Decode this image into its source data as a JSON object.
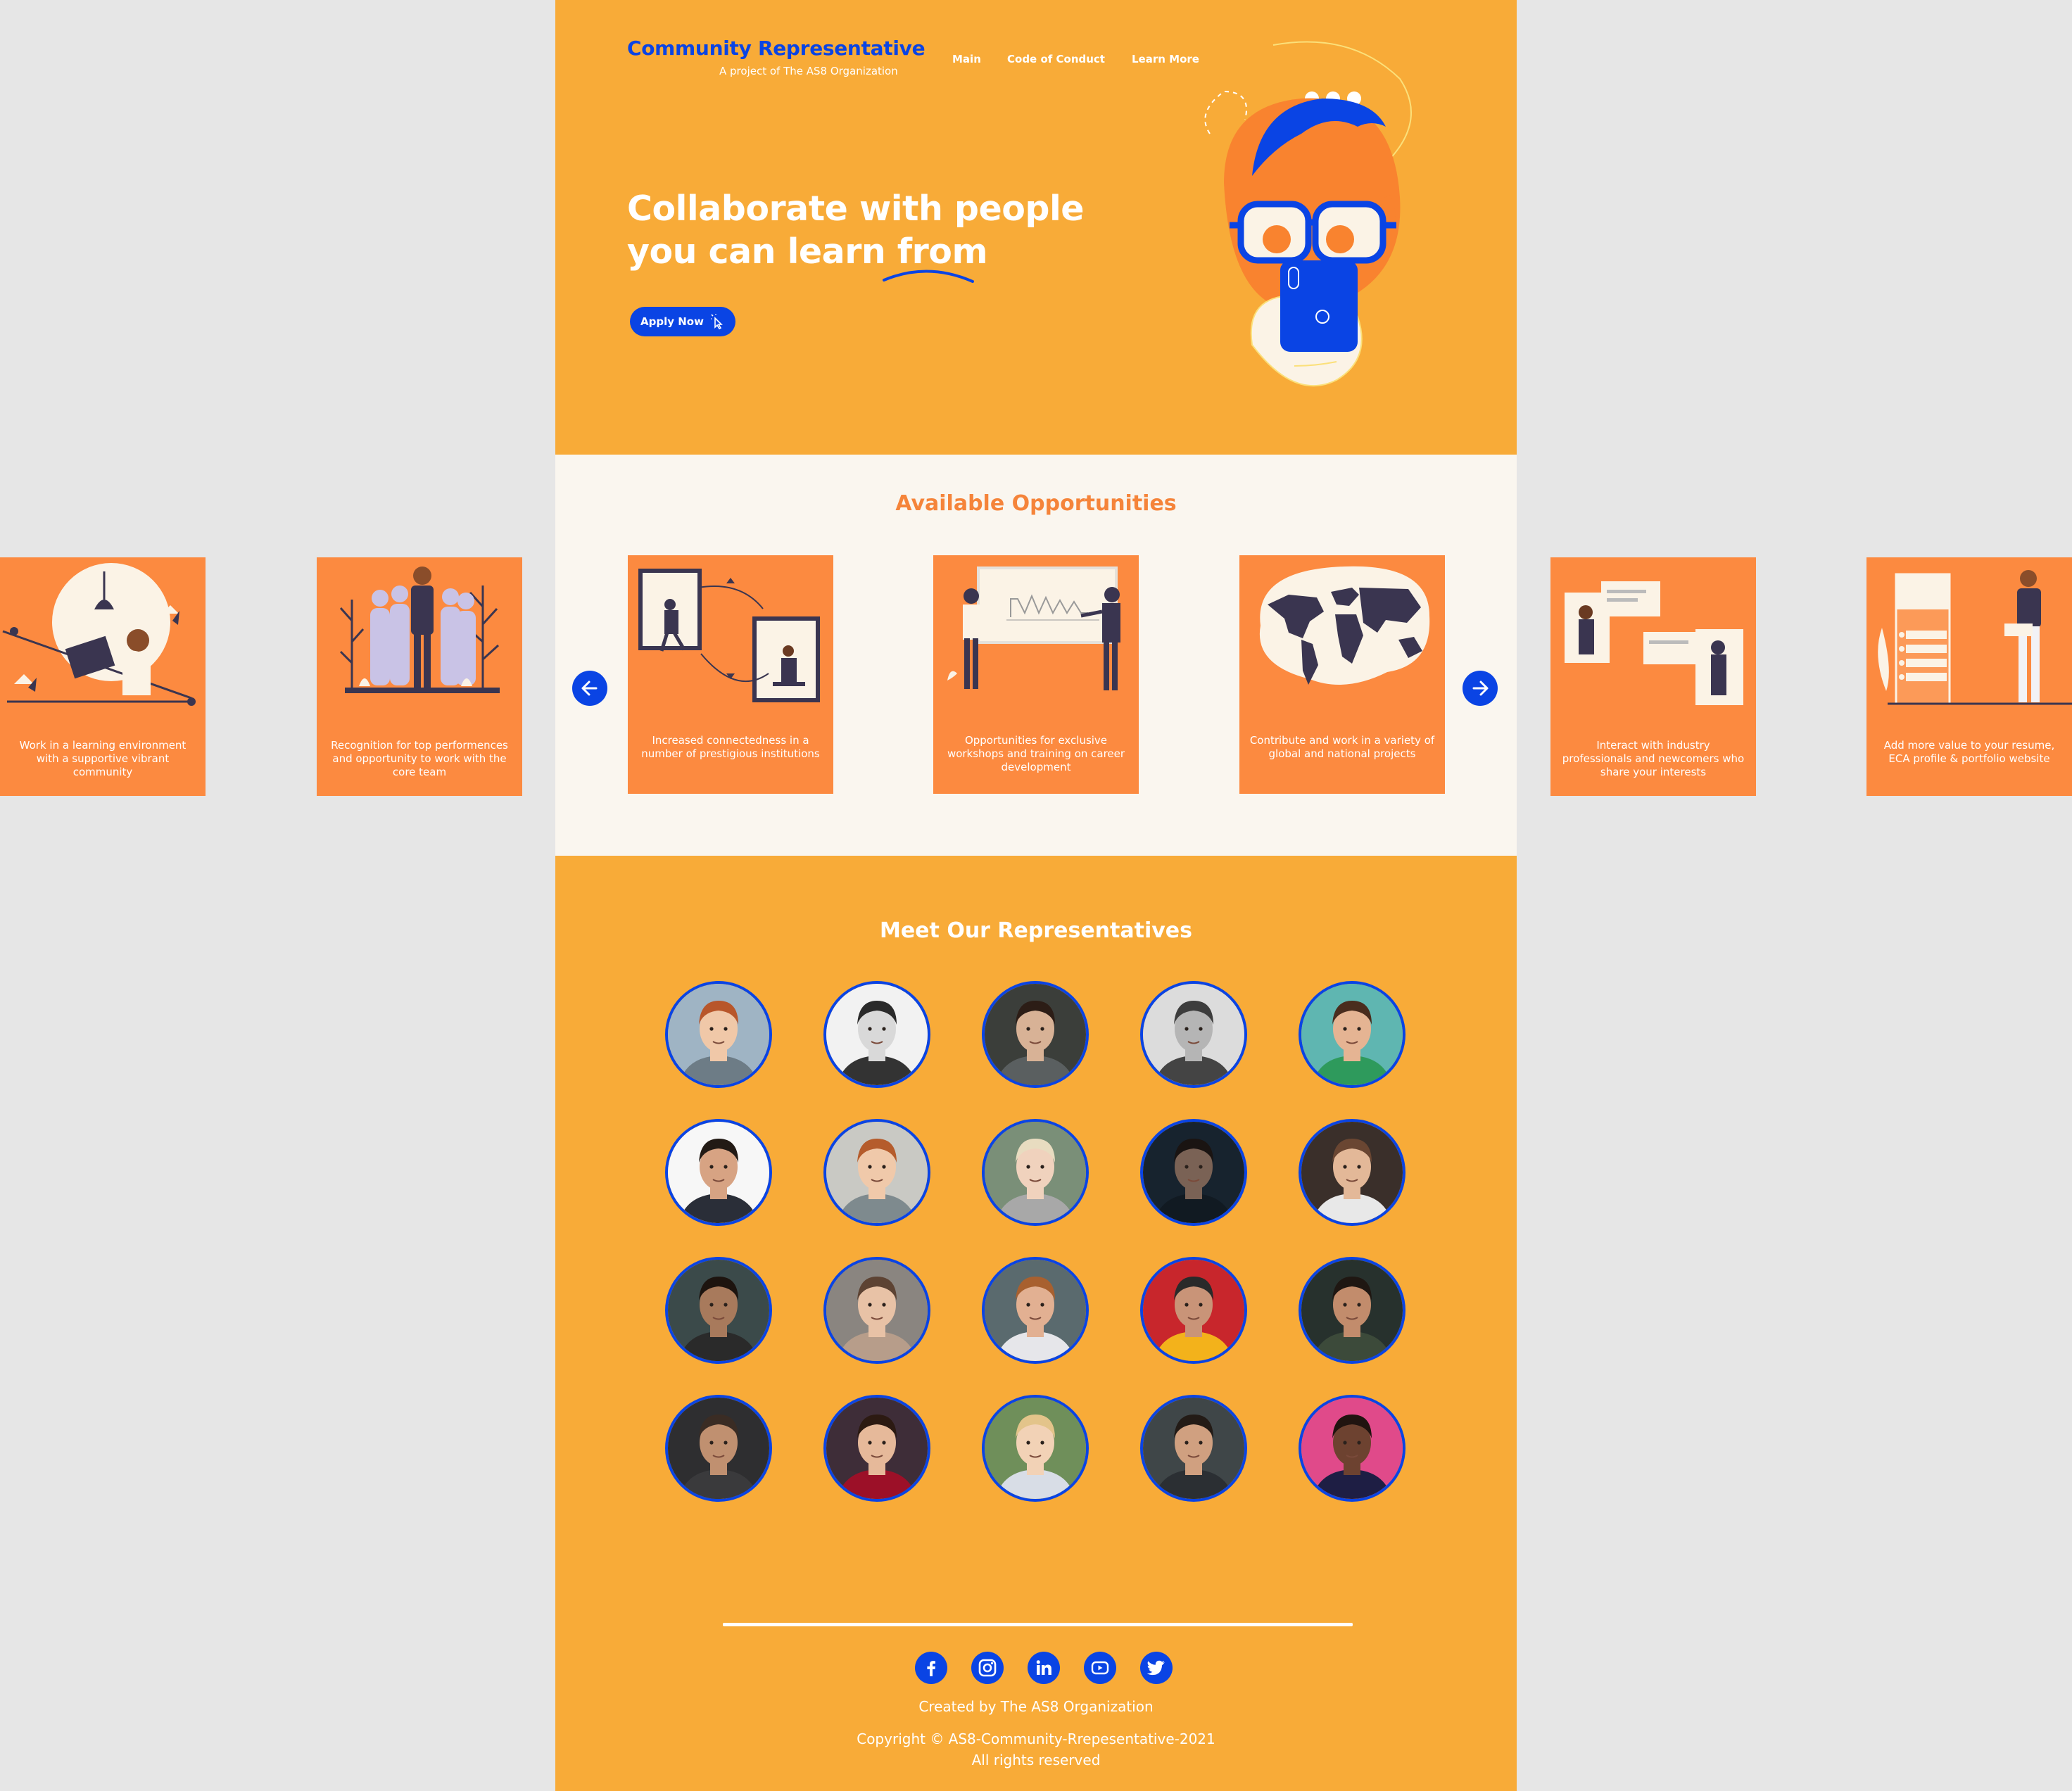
{
  "brand": {
    "title": "Community Representative",
    "subtitle": "A project of The AS8 Organization"
  },
  "nav": {
    "items": [
      {
        "label": "Main"
      },
      {
        "label": "Code of Conduct"
      },
      {
        "label": "Learn More"
      }
    ]
  },
  "hero": {
    "heading_line1": "Collaborate with people",
    "heading_line2": "you can learn from",
    "apply_label": "Apply Now",
    "cursor_icon": "pointer-cursor-icon",
    "illustration": "person-with-glasses-holding-phone"
  },
  "opportunities": {
    "title": "Available Opportunities",
    "prev_icon": "arrow-left-icon",
    "next_icon": "arrow-right-icon",
    "cards": [
      {
        "text": "Work in a learning environment with a supportive vibrant community",
        "illustration": "reading-woman"
      },
      {
        "text": "Recognition for top performences and opportunity to work with the core team",
        "illustration": "team-group"
      },
      {
        "text": "Increased connectedness in a number of prestigious institutions",
        "illustration": "connected-frames"
      },
      {
        "text": "Opportunities for exclusive workshops and training on career development",
        "illustration": "presentation-board"
      },
      {
        "text": "Contribute and work in a variety of global and national projects",
        "illustration": "world-map"
      },
      {
        "text": "Interact with industry professionals and newcomers who share your interests",
        "illustration": "chat-frames"
      },
      {
        "text": "Add more value to your resume, ECA profile & portfolio website",
        "illustration": "form-list"
      }
    ]
  },
  "representatives": {
    "title": "Meet Our Representatives",
    "people": [
      {
        "bg": "#9fb4c4",
        "skin": "#f0c8a8",
        "hair": "#b8562a",
        "shirt": "#6d7c86"
      },
      {
        "bg": "#f2f2f2",
        "skin": "#d9d9d9",
        "hair": "#2a2a2a",
        "shirt": "#333333"
      },
      {
        "bg": "#3b3e3a",
        "skin": "#d8b296",
        "hair": "#2c1d16",
        "shirt": "#5a5f60"
      },
      {
        "bg": "#dcdcdc",
        "skin": "#b5b5b5",
        "hair": "#3d3d3d",
        "shirt": "#444444"
      },
      {
        "bg": "#5fb6b1",
        "skin": "#e5b493",
        "hair": "#4a2d1e",
        "shirt": "#2e9a5c"
      },
      {
        "bg": "#f7f7f7",
        "skin": "#d7a383",
        "hair": "#221a15",
        "shirt": "#2a2e38"
      },
      {
        "bg": "#c9c9c4",
        "skin": "#f0c9aa",
        "hair": "#b55c2c",
        "shirt": "#7e8a8e"
      },
      {
        "bg": "#7a8f78",
        "skin": "#f0d2bd",
        "hair": "#e8dcc0",
        "shirt": "#a8a8a8"
      },
      {
        "bg": "#17232e",
        "skin": "#7a6255",
        "hair": "#1a1412",
        "shirt": "#111a22"
      },
      {
        "bg": "#3a2f2a",
        "skin": "#e3b898",
        "hair": "#6a4632",
        "shirt": "#e8e8e8"
      },
      {
        "bg": "#3b4a4a",
        "skin": "#a87a5c",
        "hair": "#1d140f",
        "shirt": "#2a2a2a"
      },
      {
        "bg": "#8a8580",
        "skin": "#e8c2a6",
        "hair": "#5d4333",
        "shirt": "#b79d8a"
      },
      {
        "bg": "#5a6a6e",
        "skin": "#e2b092",
        "hair": "#a8602f",
        "shirt": "#e6e6ea"
      },
      {
        "bg": "#c8262c",
        "skin": "#c99478",
        "hair": "#2a2a2a",
        "shirt": "#f3b21b"
      },
      {
        "bg": "#27312d",
        "skin": "#c28c6c",
        "hair": "#1f1712",
        "shirt": "#3c4a3a"
      },
      {
        "bg": "#2e2e30",
        "skin": "#c09070",
        "hair": "#3a2c24",
        "shirt": "#3a3a3c"
      },
      {
        "bg": "#3e2d38",
        "skin": "#e6b99a",
        "hair": "#2c1a12",
        "shirt": "#9c1028"
      },
      {
        "bg": "#6f8f5a",
        "skin": "#f2d2b6",
        "hair": "#e3c48a",
        "shirt": "#d8dde6"
      },
      {
        "bg": "#3f4648",
        "skin": "#d0a080",
        "hair": "#231b16",
        "shirt": "#2b2f33"
      },
      {
        "bg": "#e04a8a",
        "skin": "#6d4230",
        "hair": "#201410",
        "shirt": "#1e1e44"
      }
    ]
  },
  "footer": {
    "social": [
      {
        "icon": "facebook-icon"
      },
      {
        "icon": "instagram-icon"
      },
      {
        "icon": "linkedin-icon"
      },
      {
        "icon": "youtube-icon"
      },
      {
        "icon": "twitter-icon"
      }
    ],
    "created_by": "Created by The AS8 Organization",
    "copyright": "Copyright © AS8-Community-Rrepesentative-2021",
    "rights": "All rights reserved"
  },
  "colors": {
    "page_bg": "#f8ab38",
    "accent_blue": "#0a44e4",
    "card_orange": "#fc8a40",
    "section_cream": "#faf6ef",
    "heading_orange": "#f5843a"
  }
}
